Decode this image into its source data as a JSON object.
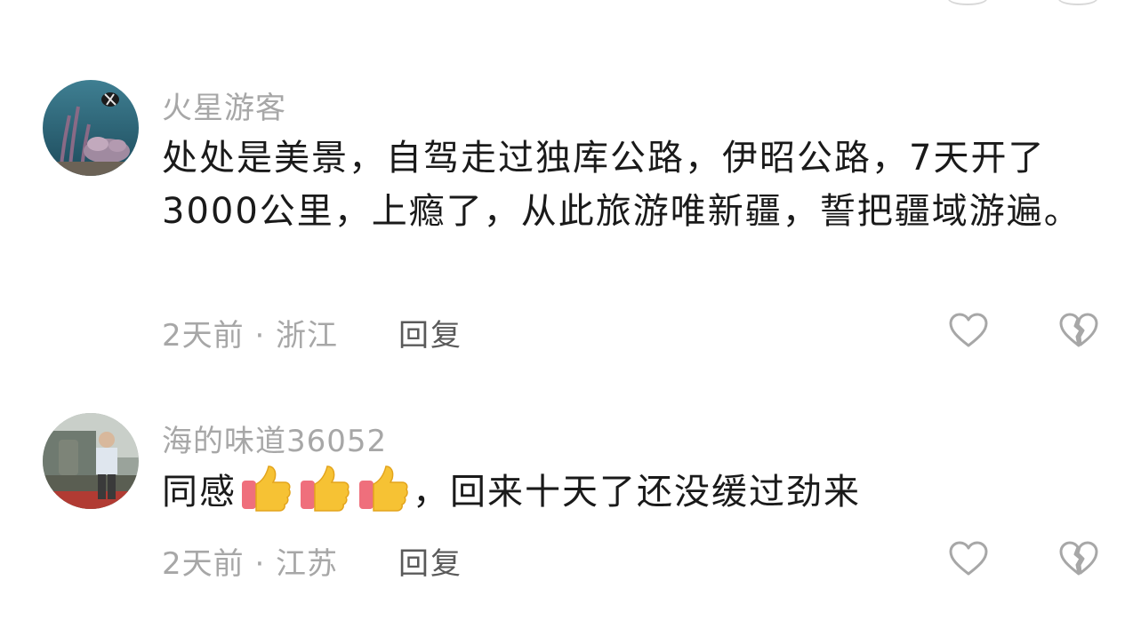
{
  "comments": [
    {
      "username": "火星游客",
      "content": "处处是美景，自驾走过独库公路，伊昭公路，7天开了3000公里，上瘾了，从此旅游唯新疆，誓把疆域游遍。",
      "meta": "2天前 · 浙江",
      "reply_label": "回复"
    },
    {
      "username": "海的味道36052",
      "content_before": "同感",
      "content_after": "，回来十天了还没缓过劲来",
      "emojis": [
        "thumbs-up",
        "thumbs-up",
        "thumbs-up"
      ],
      "meta": "2天前 · 江苏",
      "reply_label": "回复"
    }
  ],
  "icons": {
    "like": "heart-outline-icon",
    "dislike": "broken-heart-outline-icon"
  },
  "colors": {
    "secondary_text": "#a7a7a7",
    "primary_text": "#1a1a1a",
    "reply_text": "#5a5a5a",
    "icon_stroke": "#a7a7a7",
    "emoji_thumb": "#f6c234",
    "emoji_cuff": "#ef6f7c"
  }
}
